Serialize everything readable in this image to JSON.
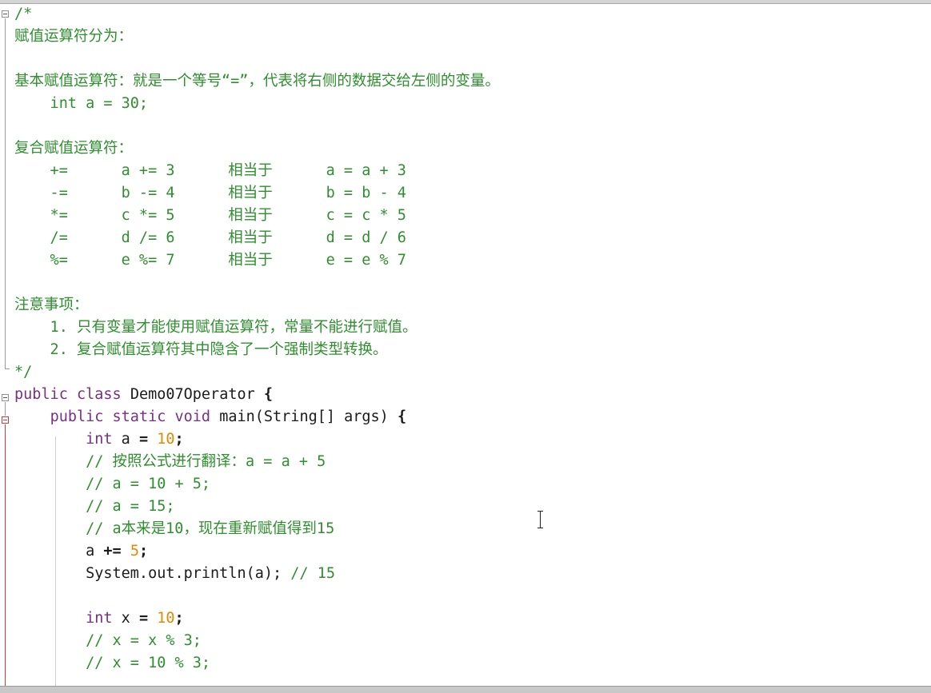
{
  "editor": {
    "lines": [
      "/*",
      "赋值运算符分为：",
      "",
      "基本赋值运算符：就是一个等号“=”，代表将右侧的数据交给左侧的变量。",
      "    int a = 30;",
      "",
      "复合赋值运算符：",
      "    +=      a += 3      相当于      a = a + 3",
      "    -=      b -= 4      相当于      b = b - 4",
      "    *=      c *= 5      相当于      c = c * 5",
      "    /=      d /= 6      相当于      d = d / 6",
      "    %=      e %= 7      相当于      e = e % 7",
      "",
      "注意事项：",
      "    1. 只有变量才能使用赋值运算符，常量不能进行赋值。",
      "    2. 复合赋值运算符其中隐含了一个强制类型转换。",
      "*/",
      "public class Demo07Operator {",
      "    public static void main(String[] args) {",
      "        int a = 10;",
      "        // 按照公式进行翻译：a = a + 5",
      "        // a = 10 + 5;",
      "        // a = 15;",
      "        // a本来是10，现在重新赋值得到15",
      "        a += 5;",
      "        System.out.println(a); // 15",
      "",
      "        int x = 10;",
      "        // x = x % 3;",
      "        // x = 10 % 3;"
    ],
    "code": {
      "kw_public": "public",
      "kw_class": "class",
      "class_name": "Demo07Operator",
      "brace_open": "{",
      "kw_static": "static",
      "kw_void": "void",
      "method_sig": "main(String[] args)",
      "kw_int": "int",
      "var_a": "a",
      "var_x": "x",
      "assign": "=",
      "plus_assign": "+=",
      "semicolon": ";",
      "num_10": "10",
      "num_5": "5",
      "println_call": "System.out.println(a);",
      "println_comment": "// 15"
    }
  },
  "colors": {
    "comment": "#2f8f2f",
    "keyword": "#7a2f86",
    "number": "#e08a00",
    "text": "#1b1b1b"
  },
  "icons": {
    "fold_marker": "fold-collapse-icon",
    "caret": "text-cursor-icon"
  }
}
